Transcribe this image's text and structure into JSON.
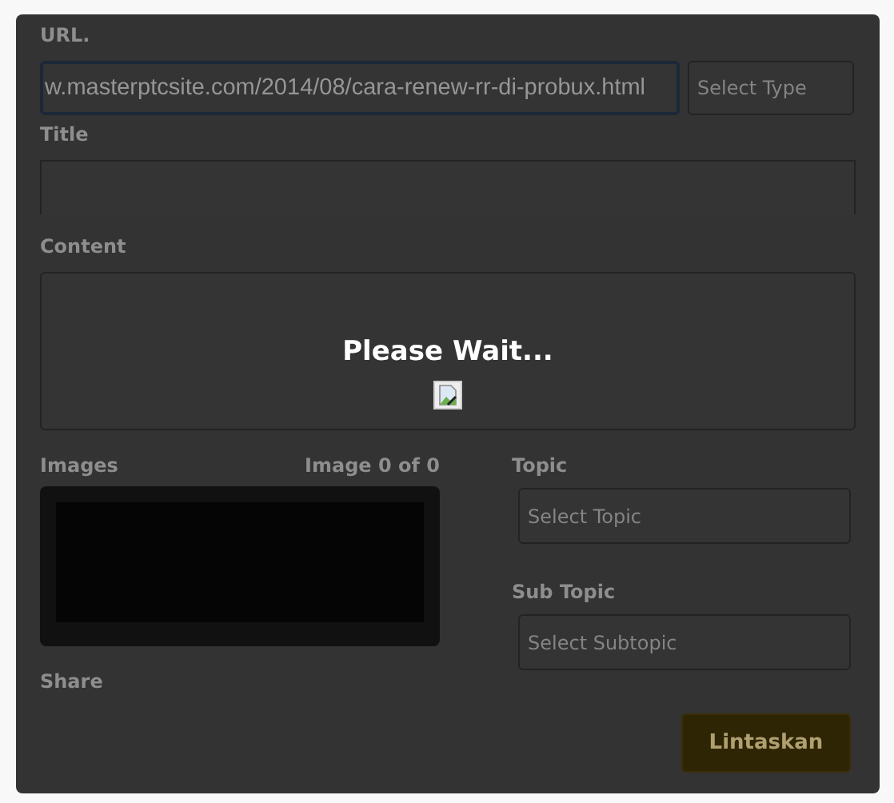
{
  "form": {
    "url": {
      "label": "URL.",
      "value": "w.masterptcsite.com/2014/08/cara-renew-rr-di-probux.html",
      "type_placeholder": "Select Type"
    },
    "title": {
      "label": "Title"
    },
    "content": {
      "label": "Content"
    },
    "images": {
      "label": "Images",
      "counter": "Image 0 of 0"
    },
    "topic": {
      "label": "Topic",
      "placeholder": "Select Topic"
    },
    "subtopic": {
      "label": "Sub Topic",
      "placeholder": "Select Subtopic"
    },
    "share": {
      "label": "Share"
    },
    "submit": "Lintaskan"
  },
  "loading": {
    "message": "Please Wait..."
  }
}
